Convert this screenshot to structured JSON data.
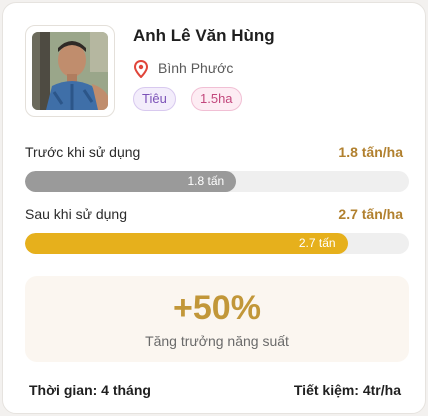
{
  "profile": {
    "name": "Anh Lê Văn Hùng",
    "location": "Bình Phước",
    "location_icon": "map-pin-icon",
    "tags": [
      "Tiêu",
      "1.5ha"
    ]
  },
  "before": {
    "label": "Trước khi sử dụng",
    "value": "1.8 tấn/ha",
    "bar_text": "1.8 tấn",
    "bar_fraction": 0.55
  },
  "after": {
    "label": "Sau khi sử dụng",
    "value": "2.7 tấn/ha",
    "bar_text": "2.7 tấn",
    "bar_fraction": 0.84
  },
  "result": {
    "headline": "+50%",
    "caption": "Tăng trưởng năng suất"
  },
  "footer": {
    "time": "Thời gian: 4 tháng",
    "savings": "Tiết kiệm: 4tr/ha"
  },
  "colors": {
    "accent_gold": "#e6b01c",
    "value_brown": "#b1802e",
    "before_gray": "#9a9a9a",
    "pin_red": "#e0453a"
  }
}
